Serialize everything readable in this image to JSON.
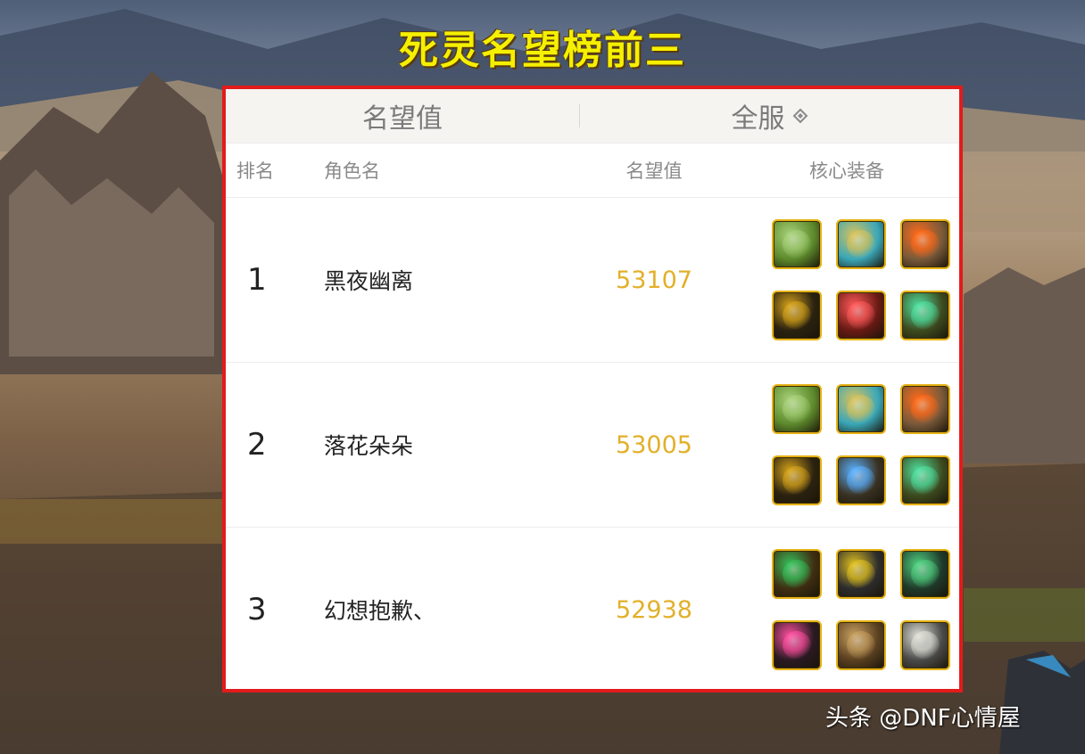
{
  "banner": {
    "title": "死灵名望榜前三"
  },
  "panel": {
    "topbar": {
      "left_label": "名望值",
      "right_label": "全服"
    },
    "columns": {
      "rank": "排名",
      "name": "角色名",
      "score": "名望值",
      "equip": "核心装备"
    },
    "rows": [
      {
        "rank": "1",
        "name": "黑夜幽离",
        "score": "53107",
        "equipment": [
          {
            "icon": "goblin-helmet-icon",
            "color": "#5d8a2c",
            "accent": "#a8d27a"
          },
          {
            "icon": "crystal-stone-icon",
            "color": "#3aa7b8",
            "accent": "#d9c25a"
          },
          {
            "icon": "atom-orb-icon",
            "color": "#7a5a3a",
            "accent": "#ff6a1a"
          },
          {
            "icon": "dark-armor-icon",
            "color": "#2b2210",
            "accent": "#d6a31a"
          },
          {
            "icon": "crimson-core-icon",
            "color": "#6a1a14",
            "accent": "#ff5a5a"
          },
          {
            "icon": "jade-armor-icon",
            "color": "#3d4b1f",
            "accent": "#4fe0a0"
          }
        ]
      },
      {
        "rank": "2",
        "name": "落花朵朵",
        "score": "53005",
        "equipment": [
          {
            "icon": "goblin-helmet-icon",
            "color": "#5d8a2c",
            "accent": "#a8d27a"
          },
          {
            "icon": "crystal-stone-icon",
            "color": "#3aa7b8",
            "accent": "#d9c25a"
          },
          {
            "icon": "atom-orb-icon",
            "color": "#7a5a3a",
            "accent": "#ff6a1a"
          },
          {
            "icon": "dark-armor-icon",
            "color": "#2b2210",
            "accent": "#d6a31a"
          },
          {
            "icon": "blue-gem-chestplate-icon",
            "color": "#3a3324",
            "accent": "#5ab0ff"
          },
          {
            "icon": "jade-armor-icon",
            "color": "#3d4b1f",
            "accent": "#4fe0a0"
          }
        ]
      },
      {
        "rank": "3",
        "name": "幻想抱歉、",
        "score": "52938",
        "equipment": [
          {
            "icon": "emerald-claw-icon",
            "color": "#3f2f12",
            "accent": "#36c05a"
          },
          {
            "icon": "dark-branch-icon",
            "color": "#2d2d2d",
            "accent": "#e0c020"
          },
          {
            "icon": "green-ring-icon",
            "color": "#1f3a2a",
            "accent": "#50d080"
          },
          {
            "icon": "pink-bracer-icon",
            "color": "#2a1a22",
            "accent": "#ff4fa0"
          },
          {
            "icon": "bronze-armor-icon",
            "color": "#5a4020",
            "accent": "#c8a060"
          },
          {
            "icon": "silver-gauntlet-icon",
            "color": "#4a4a48",
            "accent": "#e0e0d8"
          }
        ]
      }
    ]
  },
  "watermark": {
    "text": "头条 @DNF心情屋"
  }
}
